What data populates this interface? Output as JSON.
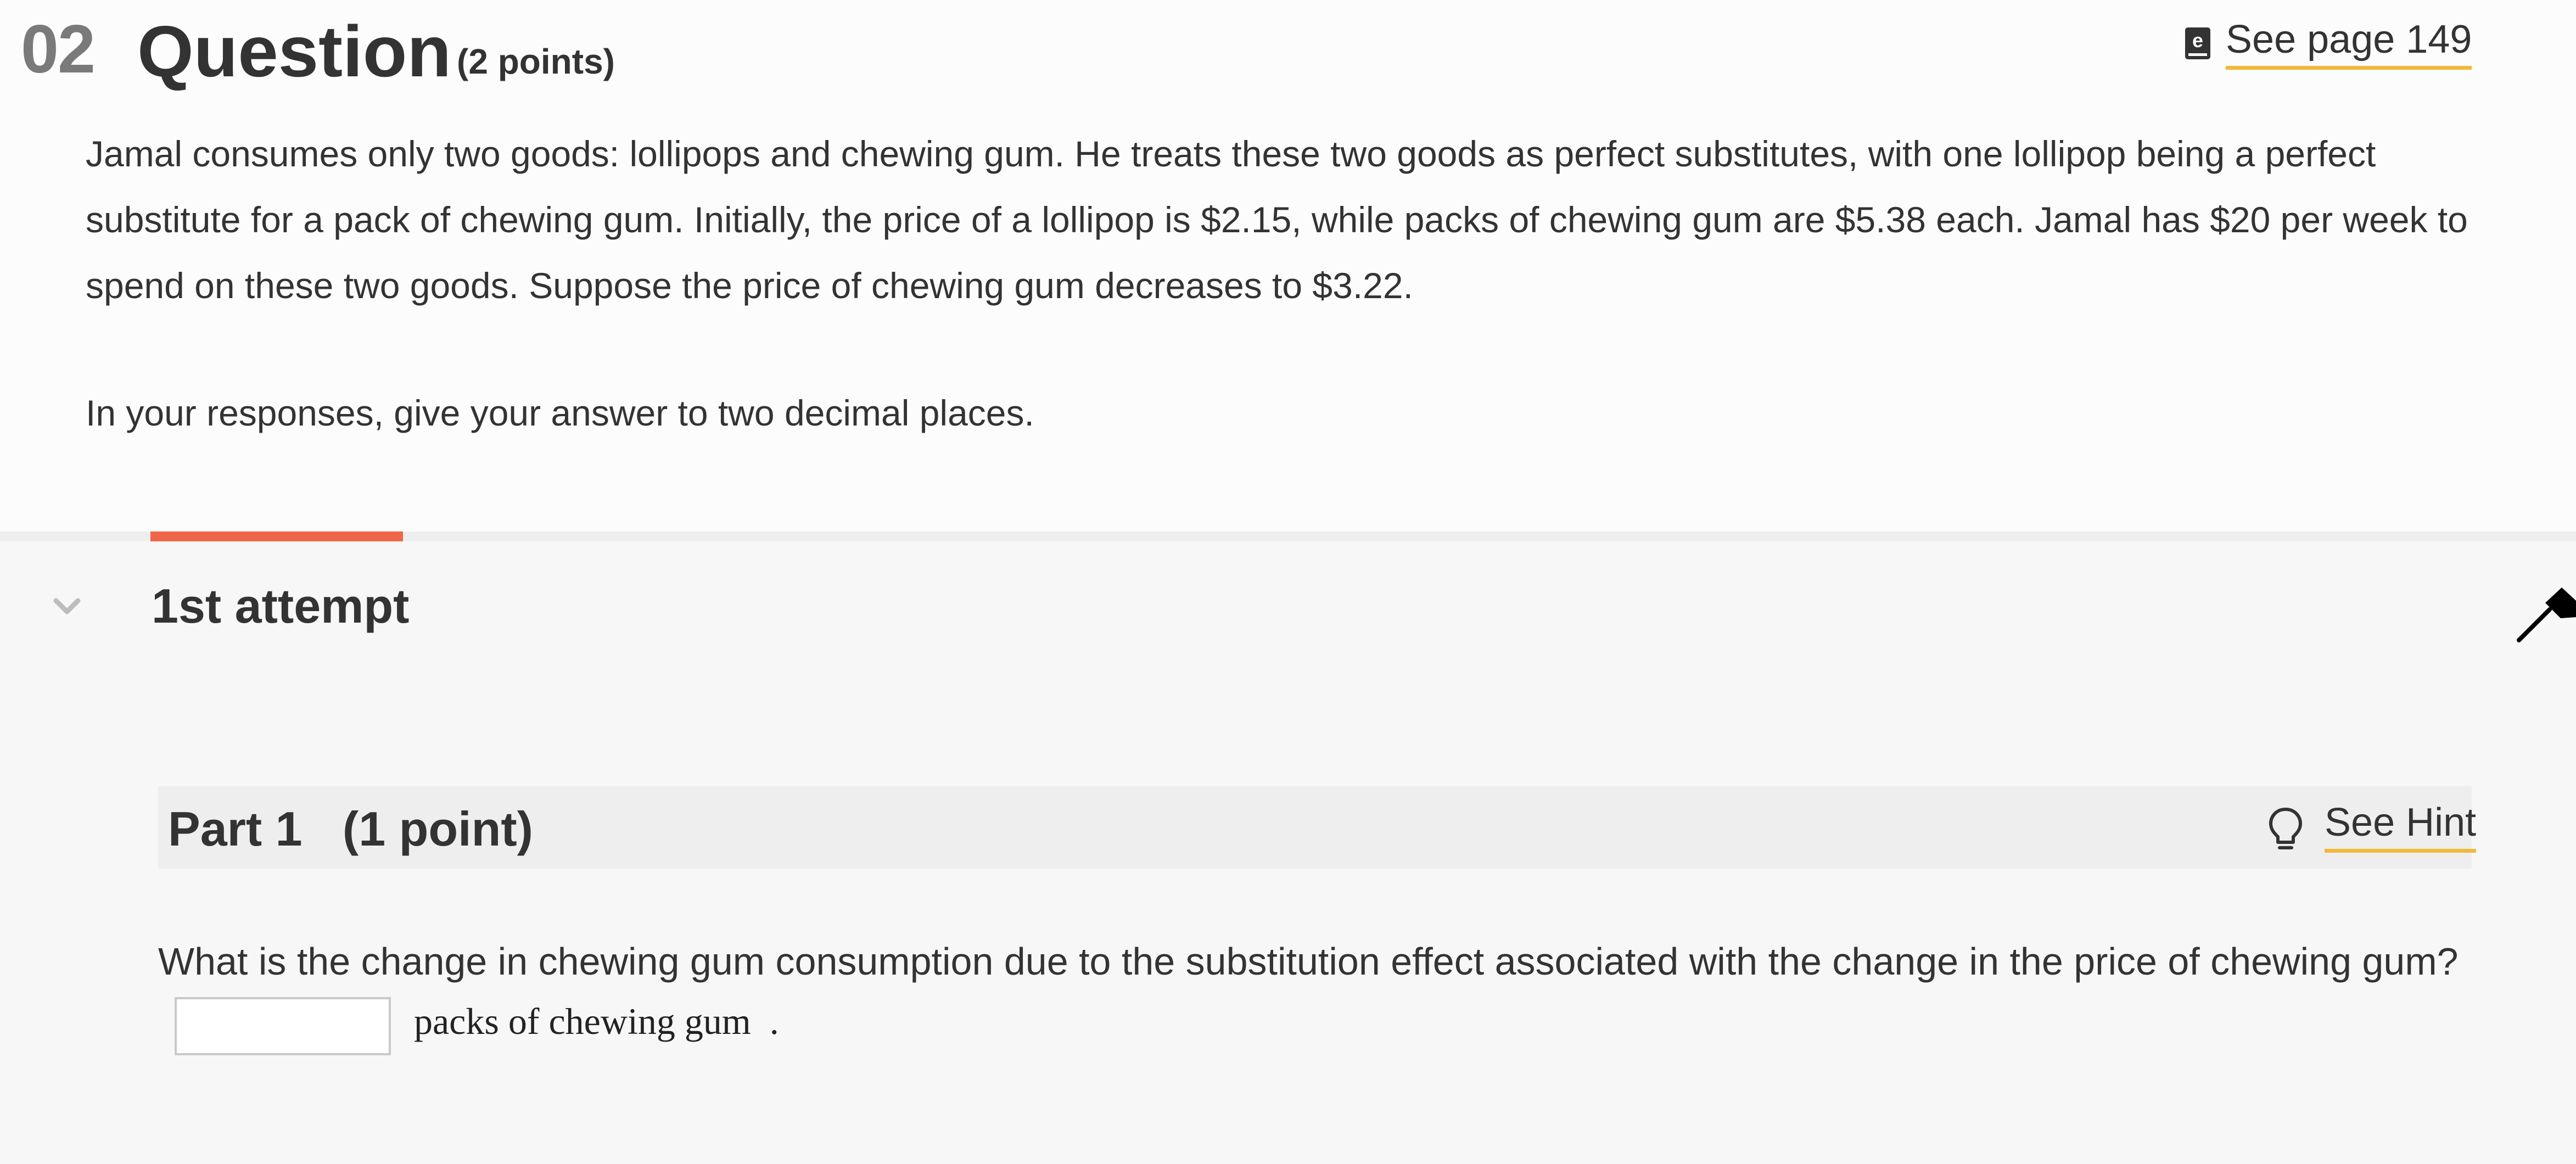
{
  "header": {
    "question_number": "02",
    "question_label": "Question",
    "points": "(2 points)",
    "see_page_link": "See page 149",
    "book_icon": "ebook-icon"
  },
  "question": {
    "body": "Jamal consumes only two goods: lollipops and chewing gum. He treats these two goods as perfect substitutes, with one lollipop being a perfect substitute for a pack of chewing gum. Initially, the price of a lollipop is $2.15, while packs of chewing gum are $5.38 each. Jamal has $20 per week to spend on these two goods. Suppose the price of chewing gum decreases to $3.22.",
    "instructions": "In your responses, give your answer to two decimal places."
  },
  "attempt": {
    "title": "1st attempt",
    "chevron_icon": "chevron-down-icon"
  },
  "part1": {
    "title": "Part 1   (1 point)",
    "hint_link": "See Hint",
    "hint_icon": "lightbulb-icon",
    "prompt": "What is the change in chewing gum consumption due to the substitution effect associated with the change in the price of chewing gum?",
    "answer_value": "",
    "unit_label": "packs of chewing gum  ."
  },
  "colors": {
    "accent_orange": "#ef6548",
    "link_underline": "#f0b93a",
    "text": "#333333",
    "muted_number": "#7a7a7a"
  }
}
